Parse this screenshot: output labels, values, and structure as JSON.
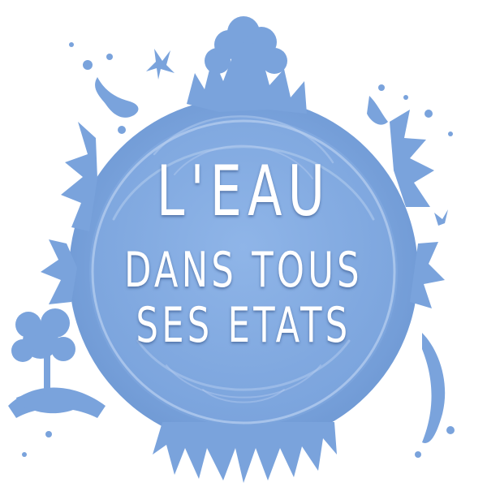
{
  "logo": {
    "line1": "L'EAU",
    "line2": "DANS TOUS",
    "line3": "SES ETATS"
  },
  "colors": {
    "globe_blue": "#7aa3dc",
    "ripple_light": "#b5cdef",
    "text": "#ffffff"
  },
  "icons": [
    "bird-icon",
    "tree-icon"
  ]
}
